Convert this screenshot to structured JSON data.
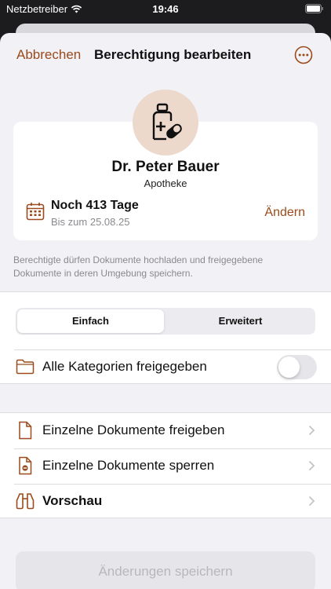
{
  "status_bar": {
    "carrier": "Netzbetreiber",
    "time": "19:46"
  },
  "nav": {
    "cancel_label": "Abbrechen",
    "title": "Berechtigung bearbeiten",
    "more_icon": "ellipsis-circle-icon"
  },
  "colors": {
    "accent": "#9a4a1b",
    "avatar_bg": "#ecd9cc",
    "sheet_bg": "#f2f1f6"
  },
  "recipient": {
    "name": "Dr. Peter Bauer",
    "role": "Apotheke",
    "avatar_icon": "pharmacy-bottle-icon"
  },
  "validity": {
    "remaining": "Noch 413 Tage",
    "until": "Bis zum 25.08.25",
    "change_label": "Ändern",
    "icon": "calendar-icon"
  },
  "info_text": "Berechtigte dürfen Dokumente hochladen und freigegebene Dokumente in deren Umgebung speichern.",
  "mode": {
    "options": [
      "Einfach",
      "Erweitert"
    ],
    "selected": "Einfach"
  },
  "all_categories": {
    "label": "Alle Kategorien freigegeben",
    "enabled": false,
    "icon": "folder-icon"
  },
  "actions": [
    {
      "label": "Einzelne Dokumente freigeben",
      "icon": "document-icon"
    },
    {
      "label": "Einzelne Dokumente sperren",
      "icon": "document-blocked-icon"
    },
    {
      "label": "Vorschau",
      "icon": "binoculars-icon"
    }
  ],
  "save_label": "Änderungen speichern"
}
